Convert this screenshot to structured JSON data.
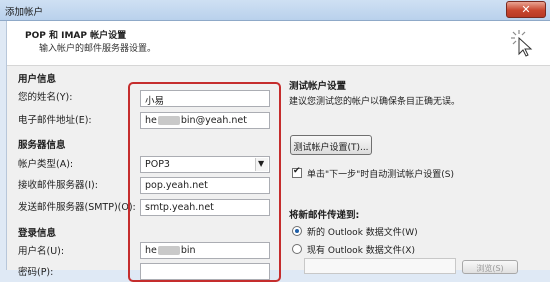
{
  "window": {
    "title": "添加帐户",
    "close_label": "✕"
  },
  "header": {
    "title": "POP 和 IMAP 帐户设置",
    "subtitle": "输入帐户的邮件服务器设置。"
  },
  "user_info": {
    "section": "用户信息",
    "name_label": "您的姓名(Y):",
    "name_value": "小易",
    "email_label": "电子邮件地址(E):",
    "email_prefix": "he",
    "email_suffix": "bin@yeah.net"
  },
  "server_info": {
    "section": "服务器信息",
    "account_type_label": "帐户类型(A):",
    "account_type_value": "POP3",
    "incoming_label": "接收邮件服务器(I):",
    "incoming_value": "pop.yeah.net",
    "outgoing_label": "发送邮件服务器(SMTP)(O):",
    "outgoing_value": "smtp.yeah.net"
  },
  "login_info": {
    "section": "登录信息",
    "username_label": "用户名(U):",
    "username_prefix": "he",
    "username_suffix": "bin",
    "password_label": "密码(P):"
  },
  "test": {
    "section": "测试帐户设置",
    "description": "建议您测试您的帐户以确保条目正确无误。",
    "button_label": "测试帐户设置(T)...",
    "checkbox_label": "单击\"下一步\"时自动测试帐户设置(S)",
    "checkbox_checked": true
  },
  "deliver": {
    "section": "将新邮件传递到:",
    "option_new": "新的 Outlook 数据文件(W)",
    "option_existing": "现有 Outlook 数据文件(X)",
    "browse_label": "浏览(S)"
  }
}
